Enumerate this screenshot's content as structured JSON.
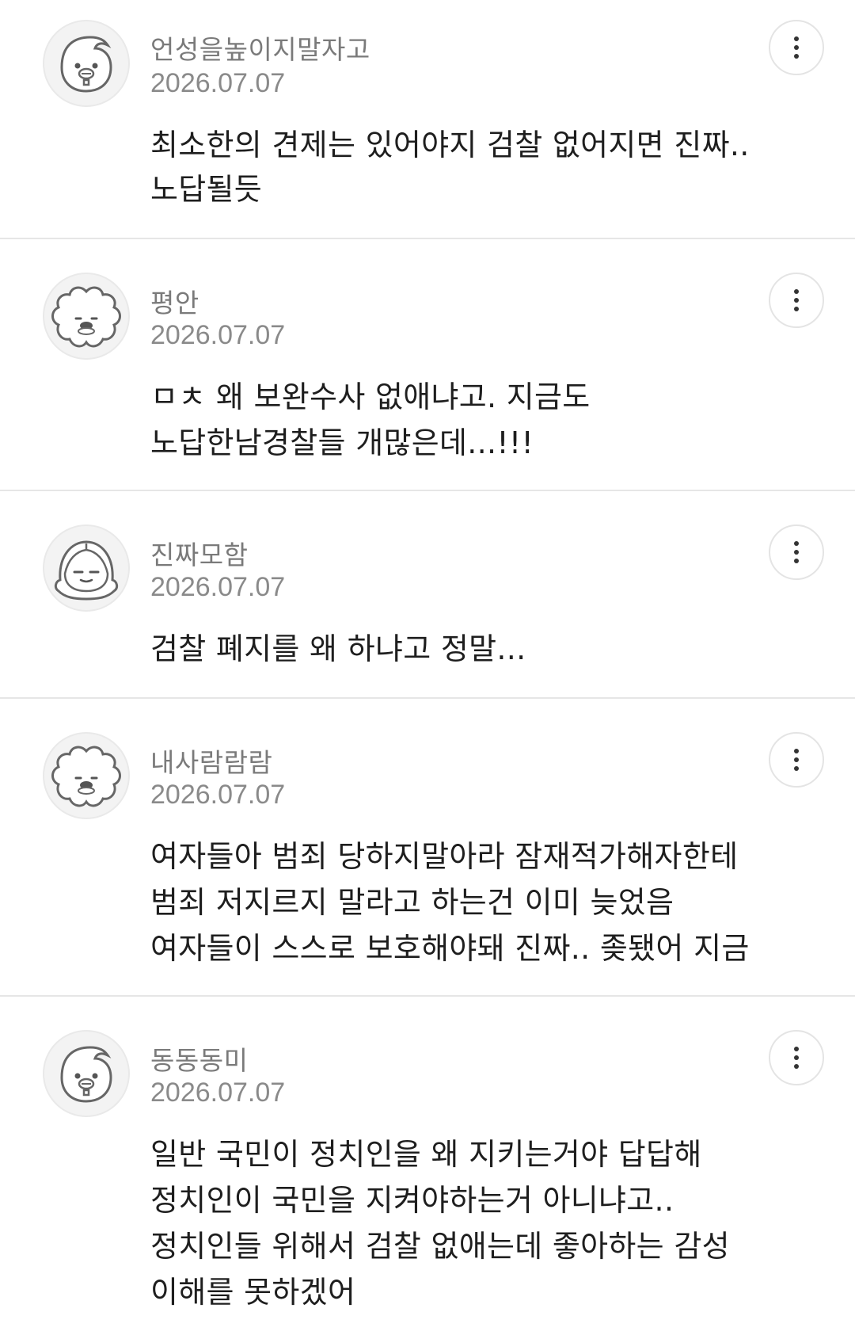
{
  "comments": [
    {
      "nickname": "언성을높이지말자고",
      "date": "2026.07.07",
      "lines": [
        "최소한의 견제는 있어야지 검찰 없어지면 진짜..",
        "노답될듯"
      ],
      "avatar_icon": "round-face-avatar-icon"
    },
    {
      "nickname": "평안",
      "date": "2026.07.07",
      "lines": [
        "ㅁㅊ 왜 보완수사 없애냐고. 지금도",
        "노답한남경찰들 개많은데...!!!"
      ],
      "avatar_icon": "fluffy-dog-avatar-icon"
    },
    {
      "nickname": "진짜모함",
      "date": "2026.07.07",
      "lines": [
        "검찰 폐지를 왜 하냐고 정말..."
      ],
      "avatar_icon": "hooded-sleepy-avatar-icon"
    },
    {
      "nickname": "내사람람람",
      "date": "2026.07.07",
      "lines": [
        "여자들아 범죄 당하지말아라 잠재적가해자한테",
        "범죄 저지르지 말라고 하는건 이미 늦었음",
        "여자들이 스스로 보호해야돼 진짜.. 좆됐어 지금"
      ],
      "avatar_icon": "fluffy-dog-avatar-icon"
    },
    {
      "nickname": "동동동미",
      "date": "2026.07.07",
      "lines": [
        "일반 국민이 정치인을 왜 지키는거야 답답해",
        "정치인이 국민을 지켜야하는거 아니냐고..",
        "정치인들 위해서 검찰 없애는데 좋아하는 감성",
        "이해를 못하겠어"
      ],
      "avatar_icon": "round-face-avatar-icon"
    }
  ],
  "more_icon": "more-vertical-icon",
  "colors": {
    "nickname": "#7a7a7a",
    "date": "#8a8a8a",
    "body": "#1e1e1e",
    "divider": "#e6e6e6"
  }
}
